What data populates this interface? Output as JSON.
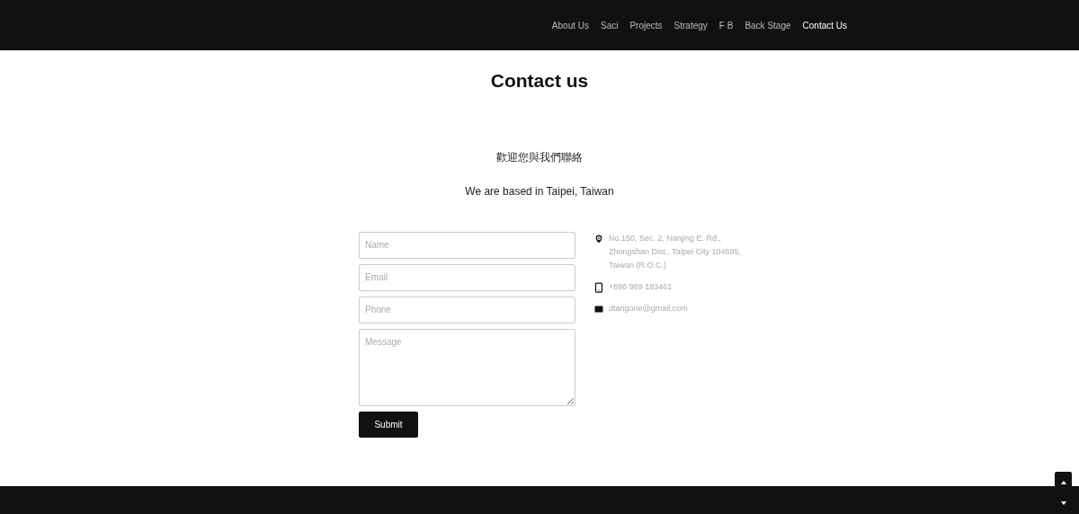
{
  "nav": [
    {
      "label": "About Us",
      "selected": false
    },
    {
      "label": "Saci",
      "selected": false
    },
    {
      "label": "Projects",
      "selected": false
    },
    {
      "label": "Strategy",
      "selected": false
    },
    {
      "label": "F B",
      "selected": false
    },
    {
      "label": "Back Stage",
      "selected": false
    },
    {
      "label": "Contact Us",
      "selected": true
    }
  ],
  "title": "Contact us",
  "intro": [
    "歡迎您與我們聯絡",
    "We are based in Taipei, Taiwan"
  ],
  "form": {
    "fields": [
      {
        "kind": "input",
        "placeholder": "Name"
      },
      {
        "kind": "input",
        "placeholder": "Email"
      },
      {
        "kind": "input",
        "placeholder": "Phone"
      },
      {
        "kind": "textarea",
        "placeholder": "Message"
      }
    ],
    "submit": "Submit"
  },
  "contact": [
    {
      "kind": "address",
      "text": "No.150, Sec. 2, Nanjing E. Rd., Zhongshan Dist., Taipei City 104695, Taiwan (R.O.C.)"
    },
    {
      "kind": "phone",
      "text": "+886 989 183461"
    },
    {
      "kind": "email",
      "text": "dtangone@gmail.com"
    }
  ]
}
